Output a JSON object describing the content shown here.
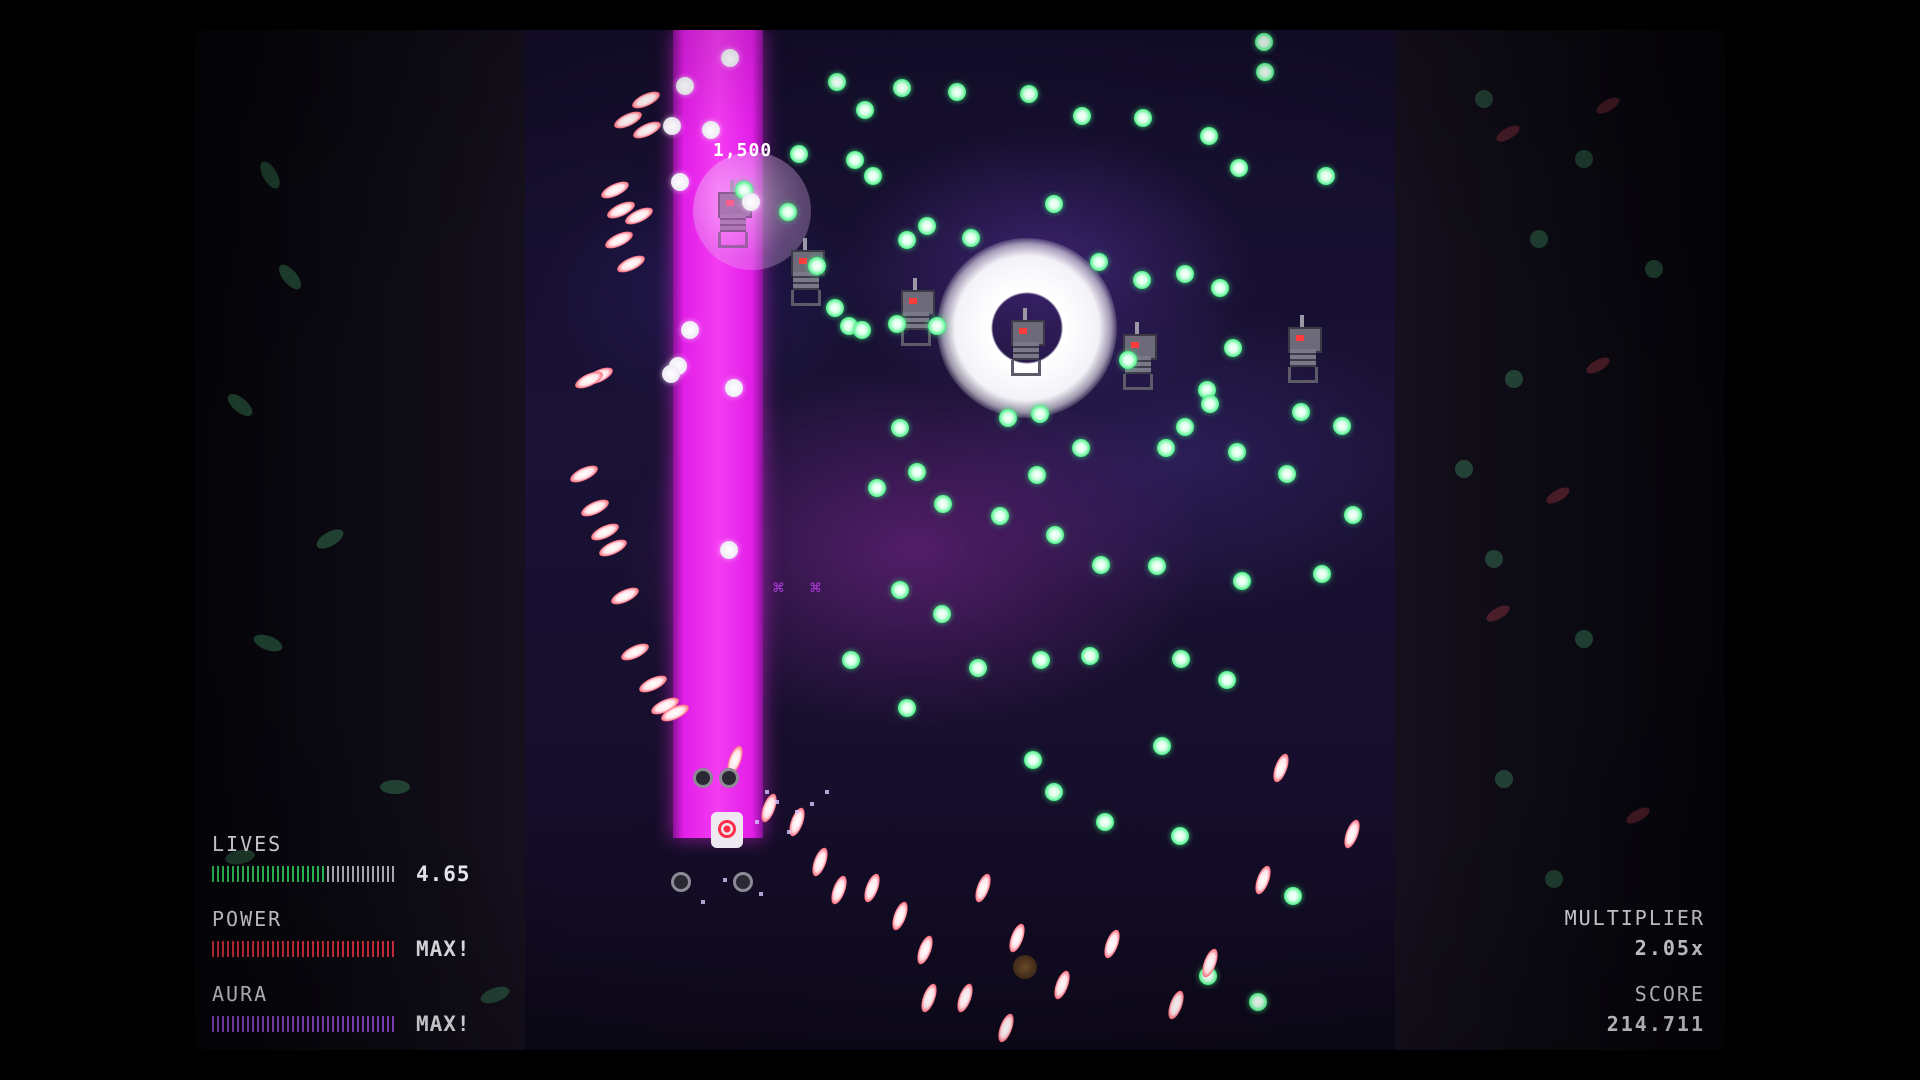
{
  "hud": {
    "lives": {
      "label": "LIVES",
      "value": "4.65",
      "fill_fraction": 0.62,
      "color": "#2fd05e"
    },
    "power": {
      "label": "POWER",
      "value": "MAX!",
      "fill_fraction": 1.0,
      "color": "#e2313f"
    },
    "aura": {
      "label": "AURA",
      "value": "MAX!",
      "fill_fraction": 1.0,
      "color": "#9b4ce0"
    },
    "multiplier": {
      "label": "MULTIPLIER",
      "value": "2.05x"
    },
    "score": {
      "label": "SCORE",
      "value": "214.711"
    }
  },
  "playfield": {
    "score_popup": "1,500",
    "beam_color": "#f43cf2",
    "enemy_count": 6
  },
  "colors": {
    "background": "#000000",
    "green_bullet": "#4ef48a",
    "red_bullet": "#ff3a50",
    "enemy_eye": "#ff3b3b"
  }
}
